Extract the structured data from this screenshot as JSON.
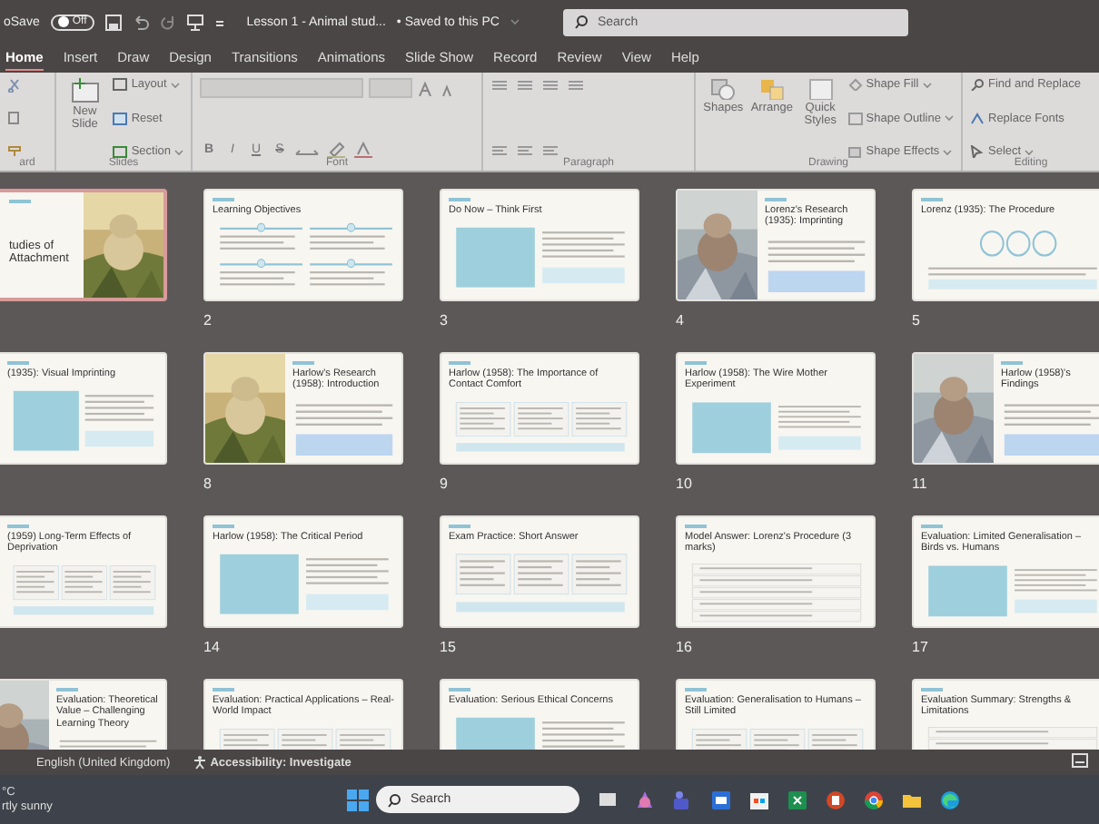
{
  "title_bar": {
    "autosave_label": "oSave",
    "autosave_toggle": "Off",
    "autosave_on": false,
    "document_title": "Lesson 1 - Animal stud...",
    "save_status": "• Saved to this PC",
    "search_placeholder": "Search"
  },
  "tabs": [
    {
      "label": "Home",
      "selected": true
    },
    {
      "label": "Insert",
      "selected": false
    },
    {
      "label": "Draw",
      "selected": false
    },
    {
      "label": "Design",
      "selected": false
    },
    {
      "label": "Transitions",
      "selected": false
    },
    {
      "label": "Animations",
      "selected": false
    },
    {
      "label": "Slide Show",
      "selected": false
    },
    {
      "label": "Record",
      "selected": false
    },
    {
      "label": "Review",
      "selected": false
    },
    {
      "label": "View",
      "selected": false
    },
    {
      "label": "Help",
      "selected": false
    }
  ],
  "ribbon": {
    "clipboard": {
      "label": "ard"
    },
    "slides": {
      "new_slide": "New Slide",
      "layout": "Layout",
      "reset": "Reset",
      "section": "Section",
      "label": "Slides"
    },
    "font": {
      "bold": "B",
      "italic": "I",
      "underline": "U",
      "strike": "S",
      "label": "Font"
    },
    "paragraph": {
      "label": "Paragraph"
    },
    "drawing": {
      "shapes": "Shapes",
      "arrange": "Arrange",
      "quick_styles": "Quick Styles",
      "shape_fill": "Shape Fill",
      "shape_outline": "Shape Outline",
      "shape_effects": "Shape Effects",
      "label": "Drawing"
    },
    "editing": {
      "find_replace": "Find and Replace",
      "replace_fonts": "Replace Fonts",
      "select": "Select",
      "label": "Editing"
    }
  },
  "slides": [
    {
      "title": "tudies of Attachment",
      "kind": "cover",
      "selected": true
    },
    {
      "number": "2",
      "title": "Learning Objectives",
      "kind": "grid",
      "selected": false
    },
    {
      "number": "3",
      "title": "Do Now – Think First",
      "kind": "boxes",
      "selected": false
    },
    {
      "number": "4",
      "title": "Lorenz's Research (1935): Imprinting",
      "kind": "picture",
      "selected": false
    },
    {
      "number": "5",
      "title": "Lorenz (1935): The Procedure",
      "kind": "circles",
      "selected": false
    },
    {
      "title": "(1935): Visual Imprinting",
      "kind": "boxes",
      "selected": false
    },
    {
      "number": "8",
      "title": "Harlow's Research (1958): Introduction",
      "kind": "picture",
      "selected": false
    },
    {
      "number": "9",
      "title": "Harlow (1958): The Importance of Contact Comfort",
      "kind": "columns",
      "selected": false
    },
    {
      "number": "10",
      "title": "Harlow (1958): The Wire Mother Experiment",
      "kind": "boxes",
      "selected": false
    },
    {
      "number": "11",
      "title": "Harlow (1958)'s Findings",
      "kind": "picture",
      "selected": false
    },
    {
      "title": "(1959) Long-Term Effects of Deprivation",
      "kind": "columns",
      "selected": false
    },
    {
      "number": "14",
      "title": "Harlow (1958): The Critical Period",
      "kind": "boxes",
      "selected": false
    },
    {
      "number": "15",
      "title": "Exam Practice: Short Answer",
      "kind": "columns",
      "selected": false
    },
    {
      "number": "16",
      "title": "Model Answer: Lorenz's Procedure (3 marks)",
      "kind": "list",
      "selected": false
    },
    {
      "number": "17",
      "title": "Evaluation: Limited Generalisation – Birds vs. Humans",
      "kind": "boxes",
      "selected": false
    },
    {
      "title": "Evaluation: Theoretical Value – Challenging Learning Theory",
      "kind": "picture",
      "selected": false
    },
    {
      "title": "Evaluation: Practical Applications – Real-World Impact",
      "kind": "columns",
      "selected": false
    },
    {
      "title": "Evaluation: Serious Ethical Concerns",
      "kind": "boxes",
      "selected": false
    },
    {
      "title": "Evaluation: Generalisation to Humans – Still Limited",
      "kind": "columns",
      "selected": false
    },
    {
      "title": "Evaluation Summary: Strengths & Limitations",
      "kind": "list",
      "selected": false
    }
  ],
  "status_bar": {
    "language": "English (United Kingdom)",
    "accessibility": "Accessibility: Investigate"
  },
  "taskbar": {
    "temperature": "°C",
    "weather": "rtly sunny",
    "search_placeholder": "Search"
  }
}
